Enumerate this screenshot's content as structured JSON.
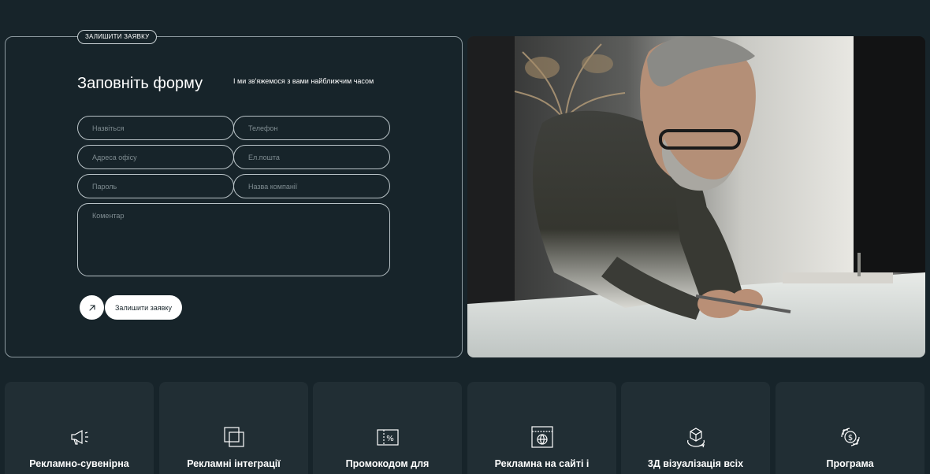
{
  "form": {
    "tag": "ЗАЛИШИТИ ЗАЯВКУ",
    "title": "Заповніть форму",
    "subtitle": "І ми зв'яжемося з вами найближчим часом",
    "fields": {
      "name": "Назвіться",
      "phone": "Телефон",
      "address": "Адреса офісу",
      "email": "Ел.пошта",
      "password": "Пароль",
      "company": "Назва компанії",
      "comment": "Коментар"
    },
    "submit_label": "Залишити заявку",
    "submit_icon": "arrow-up-right-icon"
  },
  "photo": {
    "subject": "architect-drawing-photo"
  },
  "services": [
    {
      "icon": "megaphone-icon",
      "title": "Рекламно-сувенірна"
    },
    {
      "icon": "layers-icon",
      "title": "Рекламні інтеграції"
    },
    {
      "icon": "promo-ticket-icon",
      "title": "Промокодом для"
    },
    {
      "icon": "web-window-icon",
      "title": "Рекламна на сайті і"
    },
    {
      "icon": "cube-3d-icon",
      "title": "3Д візуалізація всіх"
    },
    {
      "icon": "money-cycle-icon",
      "title": "Програма"
    }
  ],
  "colors": {
    "background": "#17242a",
    "card": "#212e34",
    "accent": "#ffffff"
  }
}
